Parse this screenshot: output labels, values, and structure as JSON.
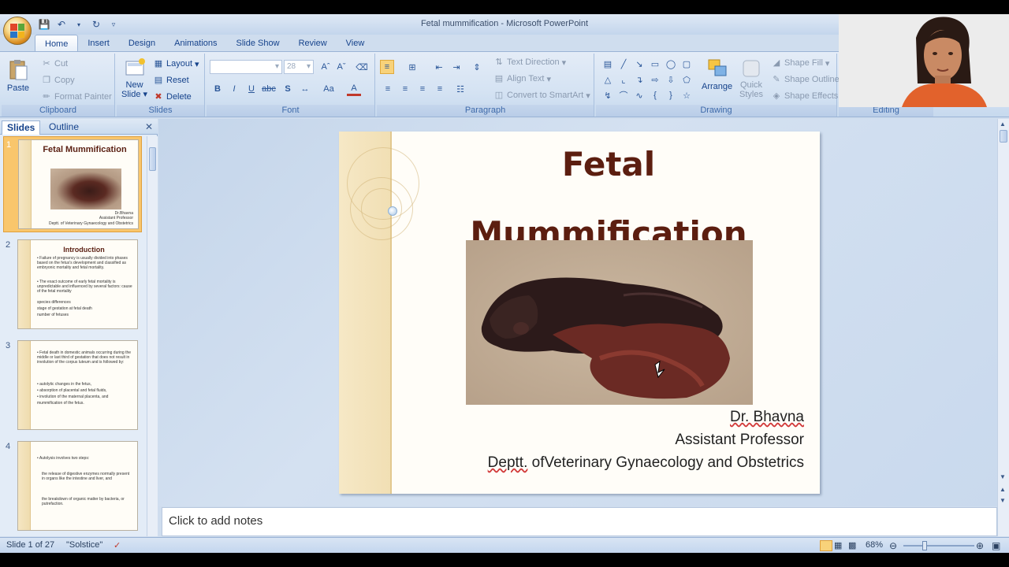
{
  "window": {
    "title": "Fetal mummification - Microsoft PowerPoint"
  },
  "tabs": [
    "Home",
    "Insert",
    "Design",
    "Animations",
    "Slide Show",
    "Review",
    "View"
  ],
  "ribbon": {
    "clipboard": {
      "label": "Clipboard",
      "paste": "Paste",
      "cut": "Cut",
      "copy": "Copy",
      "format_painter": "Format Painter"
    },
    "slides": {
      "label": "Slides",
      "new_slide": "New",
      "new_slide2": "Slide",
      "layout": "Layout",
      "reset": "Reset",
      "delete": "Delete"
    },
    "font": {
      "label": "Font",
      "font_size": "28"
    },
    "paragraph": {
      "label": "Paragraph",
      "text_direction": "Text Direction",
      "align_text": "Align Text",
      "convert_smartart": "Convert to SmartArt"
    },
    "drawing": {
      "label": "Drawing",
      "arrange": "Arrange",
      "quick_styles": "Quick",
      "quick_styles2": "Styles",
      "shape_fill": "Shape Fill",
      "shape_outline": "Shape Outline",
      "shape_effects": "Shape Effects"
    },
    "editing": {
      "label": "Editing"
    }
  },
  "panel": {
    "tab_slides": "Slides",
    "tab_outline": "Outline",
    "thumbs": [
      {
        "num": "1",
        "title": "Fetal Mummification",
        "lines": [
          "Dr.Bhavna",
          "Assistant Professor",
          "Deptt. of Veterinary Gynaecology and Obstetrics"
        ]
      },
      {
        "num": "2",
        "title": "Introduction",
        "lines": [
          "• Failure of pregnancy is usually divided into phases based on the fetus's development and classified as embryonic mortality and fetal mortality.",
          "• The exact outcome of early fetal mortality is unpredictable and influenced by several factors: cause of the fetal mortality",
          "species differences",
          "stage of gestation at fetal death",
          "number of fetuses"
        ]
      },
      {
        "num": "3",
        "title": "",
        "lines": [
          "• Fetal death in domestic animals occurring during the middle or last third of gestation that does not result in involution of the corpus luteum and is followed by:",
          "• autolytic changes in the fetus,",
          "• absorption of placental and fetal fluids,",
          "• involution of the maternal placenta, and",
          "mummification of the fetus."
        ]
      },
      {
        "num": "4",
        "title": "",
        "lines": [
          "• Autolysis involves two steps:",
          "the release of digestive enzymes normally present in organs like the intestine and liver, and",
          "the breakdown of organic matter by bacteria, or putrefaction."
        ]
      }
    ]
  },
  "slide": {
    "title_line1": "Fetal",
    "title_line2": "Mummification",
    "author": "Dr. Bhavna",
    "position": "Assistant Professor",
    "dept_a": "Deptt.",
    "dept_b": " ofVeterinary Gynaecology and Obstetrics"
  },
  "notes_placeholder": "Click to add notes",
  "status": {
    "slide_of": "Slide 1 of 27",
    "theme": "\"Solstice\"",
    "zoom": "68%"
  }
}
